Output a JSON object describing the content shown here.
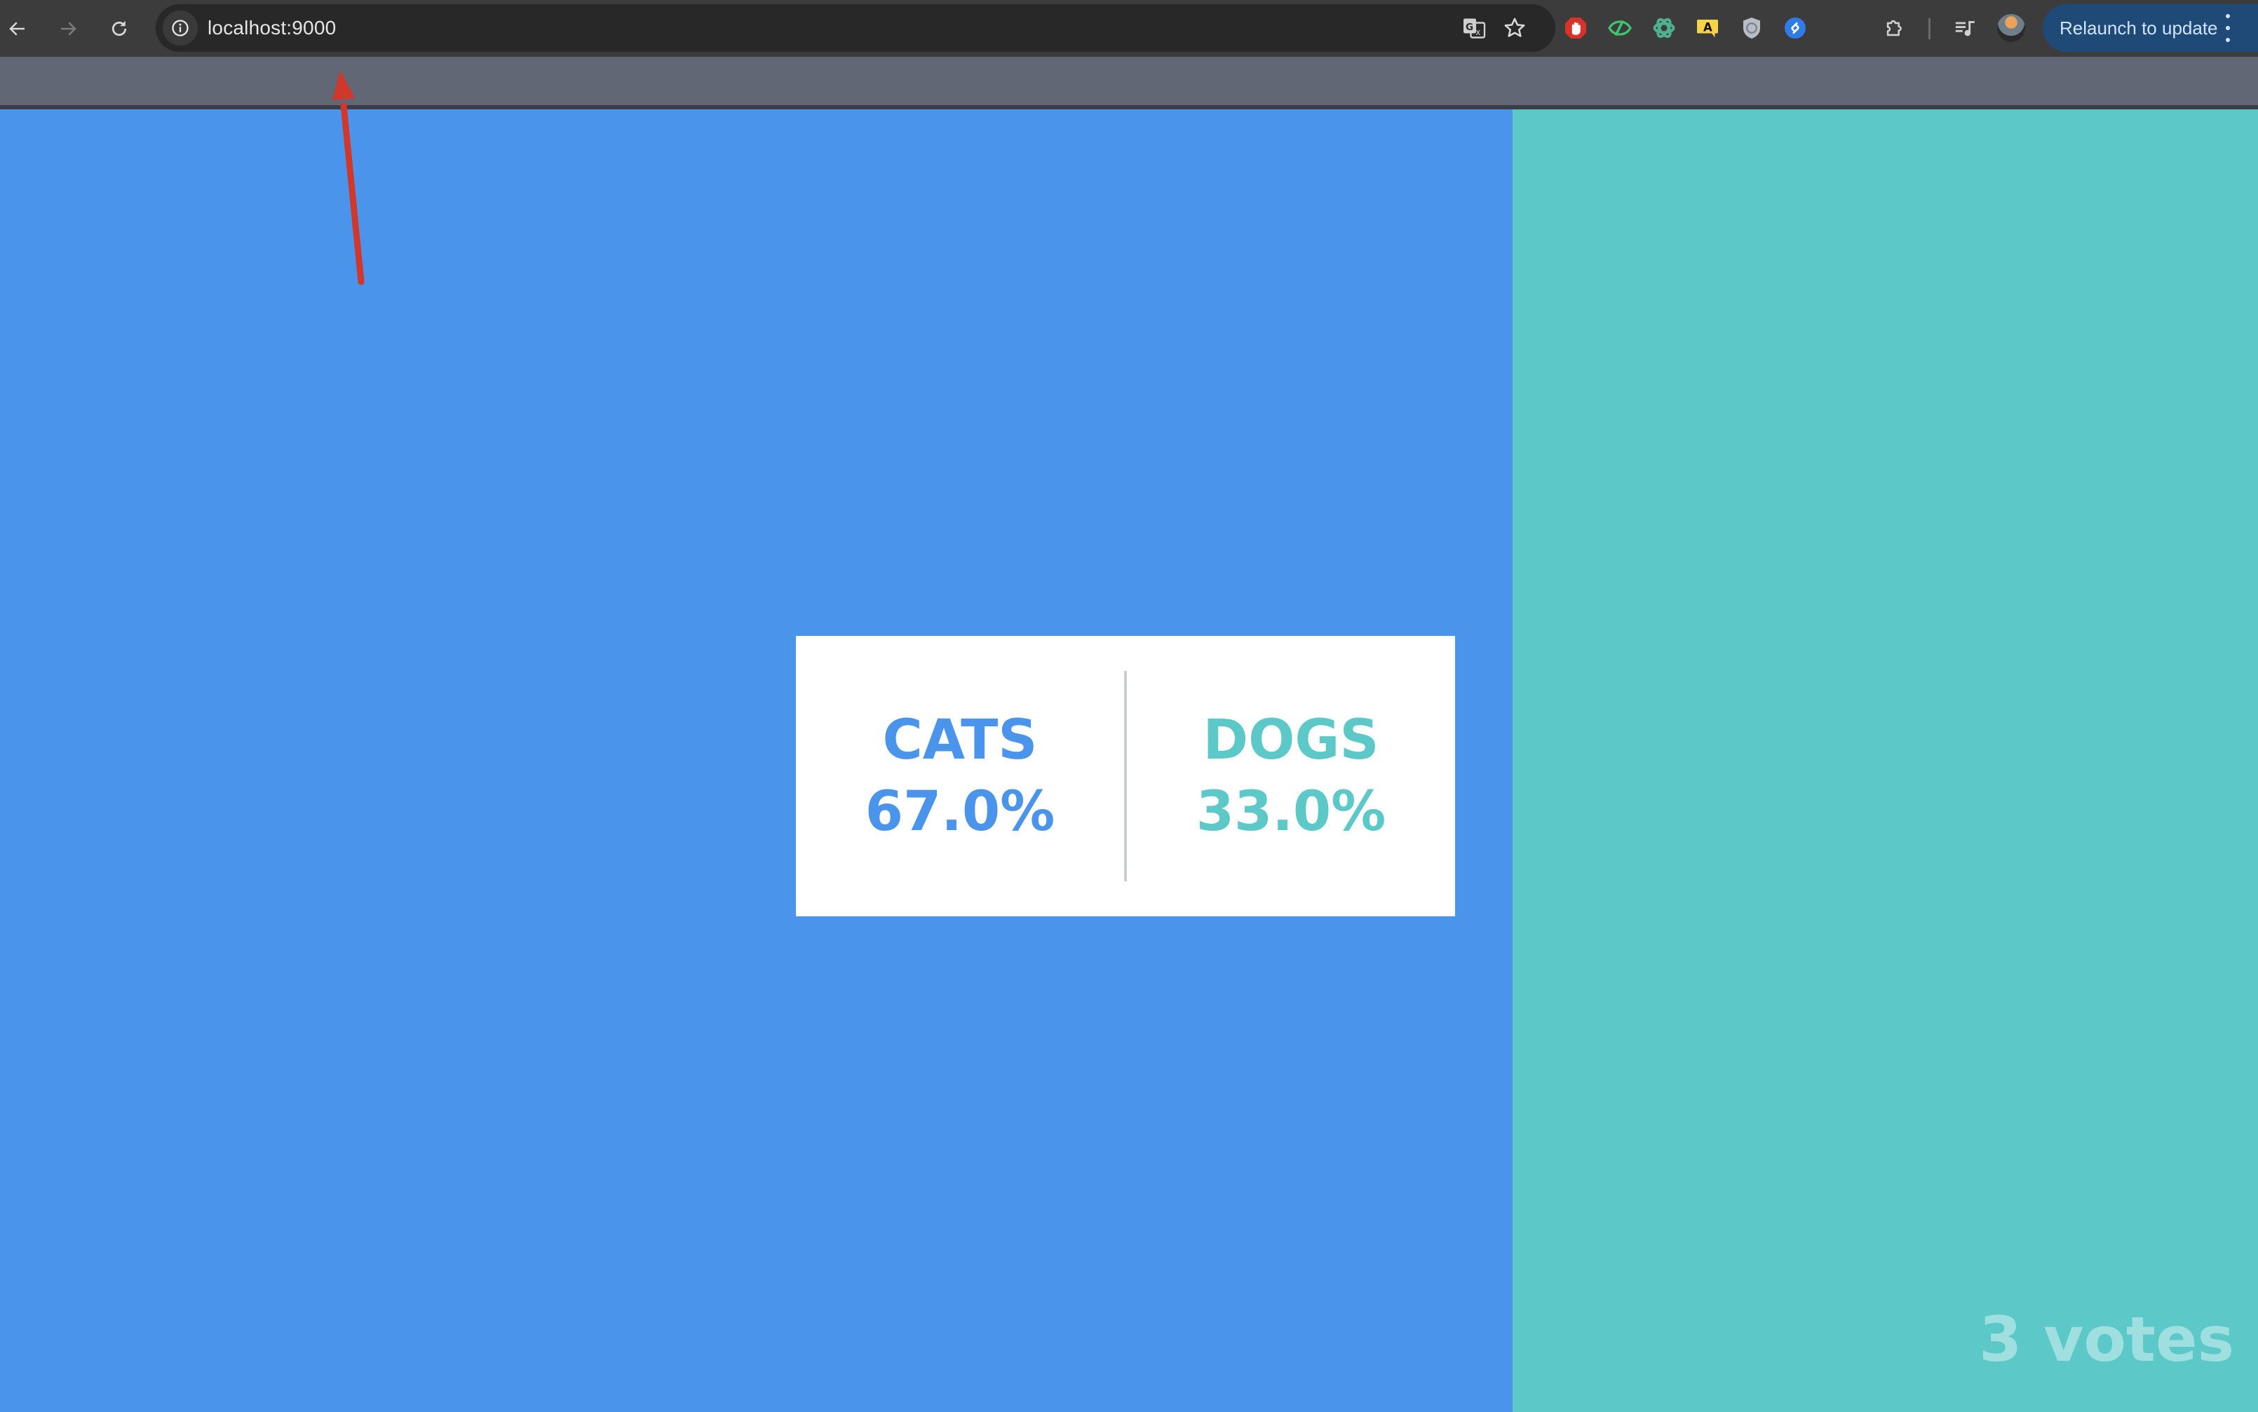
{
  "browser": {
    "url": "localhost:9000",
    "relaunch_label": "Relaunch to update",
    "nav": {
      "back_icon": "arrow-left-icon",
      "forward_icon": "arrow-right-icon",
      "reload_icon": "reload-icon"
    },
    "omnibox_icons": [
      "site-info-icon",
      "translate-icon",
      "bookmark-star-icon"
    ],
    "extensions": [
      {
        "name": "adblock-icon",
        "color": "#d8322b"
      },
      {
        "name": "eye-slash-icon",
        "color": "#3ec46d"
      },
      {
        "name": "openai-icon",
        "color": "#4fb08f"
      },
      {
        "name": "speech-a-icon",
        "color": "#f5d34a"
      },
      {
        "name": "shield-icon",
        "color": "#b9bec6"
      },
      {
        "name": "shazam-icon",
        "color": "#2f7ce8"
      },
      {
        "name": "puzzle-icon",
        "color": "#d0d0d0"
      },
      {
        "name": "media-playlist-icon",
        "color": "#d0d0d0"
      }
    ]
  },
  "poll": {
    "options": [
      {
        "label": "CATS",
        "percent_text": "67.0%",
        "share": 0.67,
        "color": "#4a95eb"
      },
      {
        "label": "DOGS",
        "percent_text": "33.0%",
        "share": 0.33,
        "color": "#5cc8c8"
      }
    ],
    "votes_text": "3 votes"
  },
  "annotation": {
    "type": "arrow",
    "color": "#d0382b",
    "points_to": "address-bar"
  }
}
